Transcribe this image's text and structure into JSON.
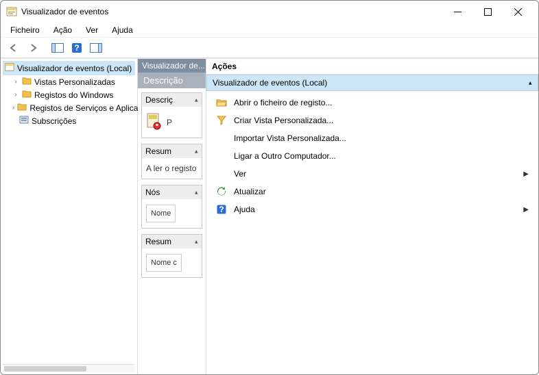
{
  "window": {
    "title": "Visualizador de eventos"
  },
  "menu": {
    "file": "Ficheiro",
    "action": "Ação",
    "view": "Ver",
    "help": "Ajuda"
  },
  "tree": {
    "root": "Visualizador de eventos (Local)",
    "items": [
      {
        "label": "Vistas Personalizadas"
      },
      {
        "label": "Registos do Windows"
      },
      {
        "label": "Registos de Serviços e Aplicações"
      },
      {
        "label": "Subscrições"
      }
    ]
  },
  "middle": {
    "tab": "Visualizador de...",
    "header": "Descrição",
    "cards": [
      {
        "title": "Descriç",
        "body_text": "P",
        "icon": "book"
      },
      {
        "title": "Resum",
        "body_text": "A ler o registo"
      },
      {
        "title": "Nós",
        "chip": "Nome"
      },
      {
        "title": "Resum",
        "chip": "Nome c"
      }
    ]
  },
  "actions": {
    "title": "Ações",
    "context": "Visualizador de eventos (Local)",
    "items": [
      {
        "icon": "folder-open",
        "label": "Abrir o ficheiro de registo..."
      },
      {
        "icon": "filter",
        "label": "Criar Vista Personalizada..."
      },
      {
        "icon": "none",
        "label": "Importar Vista Personalizada..."
      },
      {
        "icon": "none",
        "label": "Ligar a Outro Computador..."
      },
      {
        "icon": "none",
        "label": "Ver",
        "submenu": true
      },
      {
        "icon": "refresh",
        "label": "Atualizar"
      },
      {
        "icon": "help",
        "label": "Ajuda",
        "submenu": true
      }
    ]
  }
}
